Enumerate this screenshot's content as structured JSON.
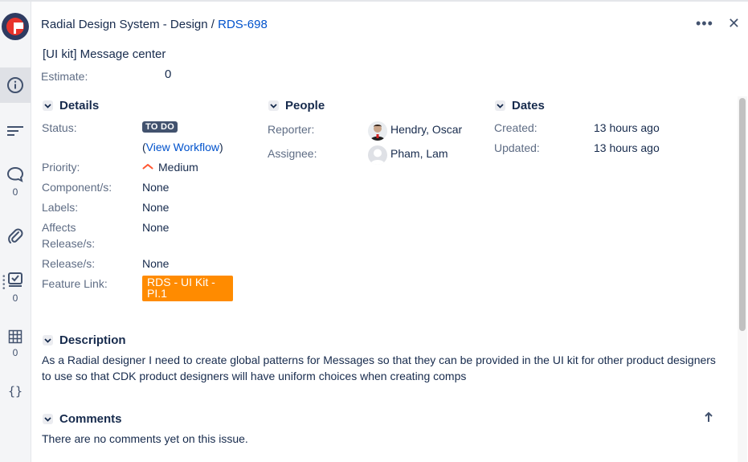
{
  "header": {
    "project": "Radial Design System - Design",
    "separator": "/",
    "issue_key": "RDS-698",
    "more_label": "•••",
    "close_label": "✕"
  },
  "issue": {
    "title": "[UI kit] Message center",
    "estimate_label": "Estimate:",
    "estimate_value": "0"
  },
  "sidebar": {
    "comments_count": "0",
    "checklist_count": "0",
    "table_count": "0"
  },
  "details": {
    "heading": "Details",
    "status_label": "Status:",
    "status_value": "TO DO",
    "workflow_open": "(",
    "workflow_link": "View Workflow",
    "workflow_close": ")",
    "priority_label": "Priority:",
    "priority_value": "Medium",
    "components_label": "Component/s:",
    "components_value": "None",
    "labels_label": "Labels:",
    "labels_value": "None",
    "affects_label_1": "Affects",
    "affects_label_2": "Release/s:",
    "affects_value": "None",
    "release_label": "Release/s:",
    "release_value": "None",
    "feature_label": "Feature Link:",
    "feature_value": "RDS - UI Kit - PI.1"
  },
  "people": {
    "heading": "People",
    "reporter_label": "Reporter:",
    "reporter_value": "Hendry, Oscar",
    "assignee_label": "Assignee:",
    "assignee_value": "Pham, Lam"
  },
  "dates": {
    "heading": "Dates",
    "created_label": "Created:",
    "created_value": "13 hours ago",
    "updated_label": "Updated:",
    "updated_value": "13 hours ago"
  },
  "description": {
    "heading": "Description",
    "text": "As a Radial designer I need to create global patterns for Messages so that they can be provided in the UI kit for other product designers to use so that CDK product designers will have uniform choices when creating comps"
  },
  "comments": {
    "heading": "Comments",
    "empty_text": "There are no comments yet on this issue."
  },
  "colors": {
    "link": "#0052cc",
    "status_badge": "#42526e",
    "feature_tag": "#ff8b00",
    "priority_medium": "#ff5630"
  },
  "icons": [
    "info-icon",
    "activity-lines-icon",
    "comment-icon",
    "paperclip-icon",
    "checklist-icon",
    "table-icon",
    "code-braces-icon",
    "chevron-down-icon",
    "arrow-up-icon"
  ]
}
